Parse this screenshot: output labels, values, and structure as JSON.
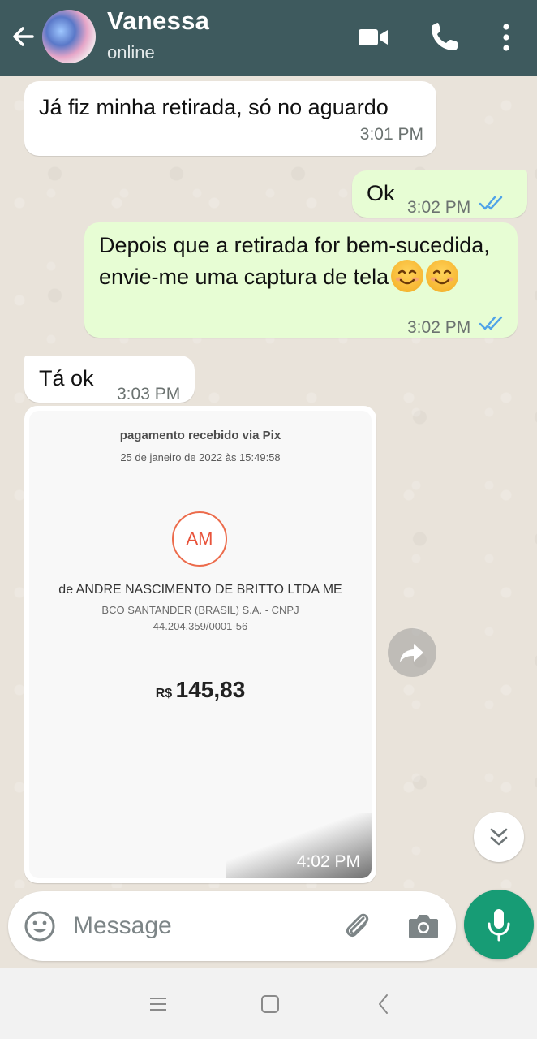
{
  "header": {
    "contact_name": "Vanessa",
    "status": "online"
  },
  "messages": [
    {
      "direction": "in",
      "text": "Já fiz minha retirada, só no aguardo",
      "time": "3:01 PM"
    },
    {
      "direction": "out",
      "text": "Ok",
      "time": "3:02 PM",
      "read": true
    },
    {
      "direction": "out",
      "text": "Depois que a retirada for bem-sucedida, envie-me uma captura de tela",
      "emojis": 2,
      "time": "3:02 PM",
      "read": true
    },
    {
      "direction": "in",
      "text": "Tá ok",
      "time": "3:03 PM"
    }
  ],
  "image_message": {
    "time": "4:02 PM",
    "receipt": {
      "title": "pagamento recebido via Pix",
      "date": "25 de janeiro de 2022 às 15:49:58",
      "logo_initials": "AM",
      "sender": "de ANDRE NASCIMENTO DE BRITTO LTDA ME",
      "bank": "BCO SANTANDER (BRASIL) S.A. - CNPJ",
      "cnpj": "44.204.359/0001-56",
      "currency": "R$",
      "amount": "145,83"
    }
  },
  "composer": {
    "placeholder": "Message"
  },
  "colors": {
    "header_bg": "#3e5a5e",
    "outgoing_bubble": "#e7fdd4",
    "incoming_bubble": "#ffffff",
    "read_ticks": "#4fa3e8",
    "mic_button": "#179c75"
  }
}
